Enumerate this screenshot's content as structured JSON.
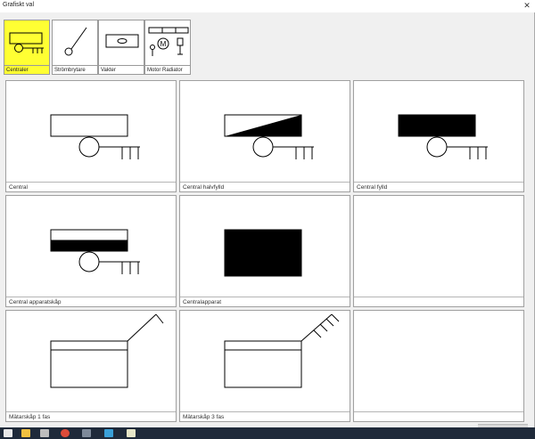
{
  "window": {
    "title": "Grafiskt val",
    "close_glyph": "✕"
  },
  "palette": {
    "tabs": [
      {
        "label": "Centraler",
        "icon": "central-panel-icon",
        "active": true
      },
      {
        "label": "Strömbrytare",
        "icon": "switch-icon",
        "active": false
      },
      {
        "label": "Vakter",
        "icon": "guard-icon",
        "active": false
      },
      {
        "label": "Motor Radiator",
        "icon": "motor-radiator-icon",
        "active": false
      }
    ]
  },
  "grid": {
    "cells": [
      {
        "label": "Central",
        "icon": "central-icon"
      },
      {
        "label": "Central halvfylld",
        "icon": "central-half-filled-icon"
      },
      {
        "label": "Central fylld",
        "icon": "central-filled-icon"
      },
      {
        "label": "Central apparatskåp",
        "icon": "central-cabinet-icon"
      },
      {
        "label": "Centralapparat",
        "icon": "central-apparatus-icon"
      },
      {
        "label": "",
        "icon": ""
      },
      {
        "label": "Mätarskåp 1 fas",
        "icon": "meter-cabinet-1-phase-icon"
      },
      {
        "label": "Mätarskåp 3 fas",
        "icon": "meter-cabinet-3-phase-icon"
      },
      {
        "label": "",
        "icon": ""
      }
    ]
  },
  "taskbar": {
    "icons": [
      "explorer-icon",
      "calculator-icon",
      "chrome-icon",
      "app-icon",
      "store-icon",
      "notepad-icon"
    ]
  },
  "colors": {
    "active_tab": "#ffff33",
    "taskbar": "#1f2a3a",
    "symbol_stroke": "#000000"
  }
}
